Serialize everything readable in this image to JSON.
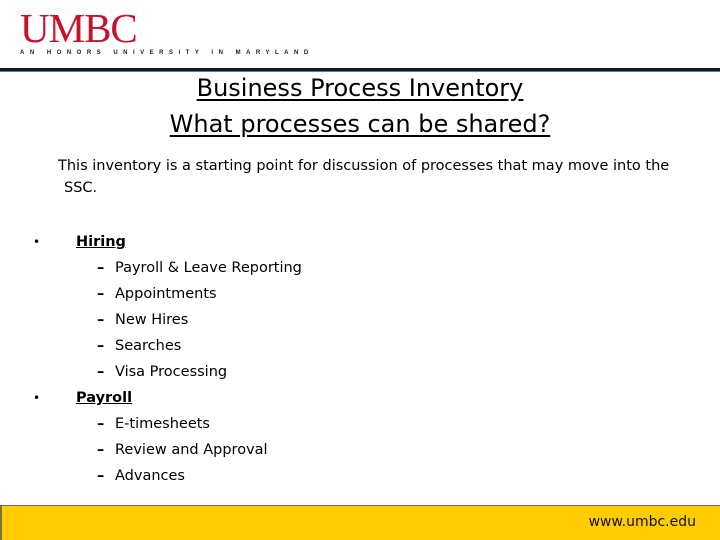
{
  "header": {
    "logo_word": "UMBC",
    "logo_tagline": "AN HONORS UNIVERSITY IN MARYLAND",
    "logo_color": "#c8102e",
    "rule_color": "#0d1a2e"
  },
  "title": {
    "line1": "Business Process Inventory",
    "line2": "What processes can be shared?"
  },
  "intro": {
    "line1": "This inventory is a starting point for discussion of processes that may move into the",
    "line2": "SSC."
  },
  "sections": [
    {
      "heading": "Hiring",
      "items": [
        "Payroll & Leave Reporting",
        "Appointments",
        "New Hires",
        "Searches",
        "Visa Processing"
      ]
    },
    {
      "heading": "Payroll",
      "items": [
        "E-timesheets",
        "Review and Approval",
        "Advances"
      ]
    }
  ],
  "glyphs": {
    "bullet": "•",
    "dash": "–"
  },
  "footer": {
    "url": "www.umbc.edu",
    "background": "#ffcc00"
  }
}
